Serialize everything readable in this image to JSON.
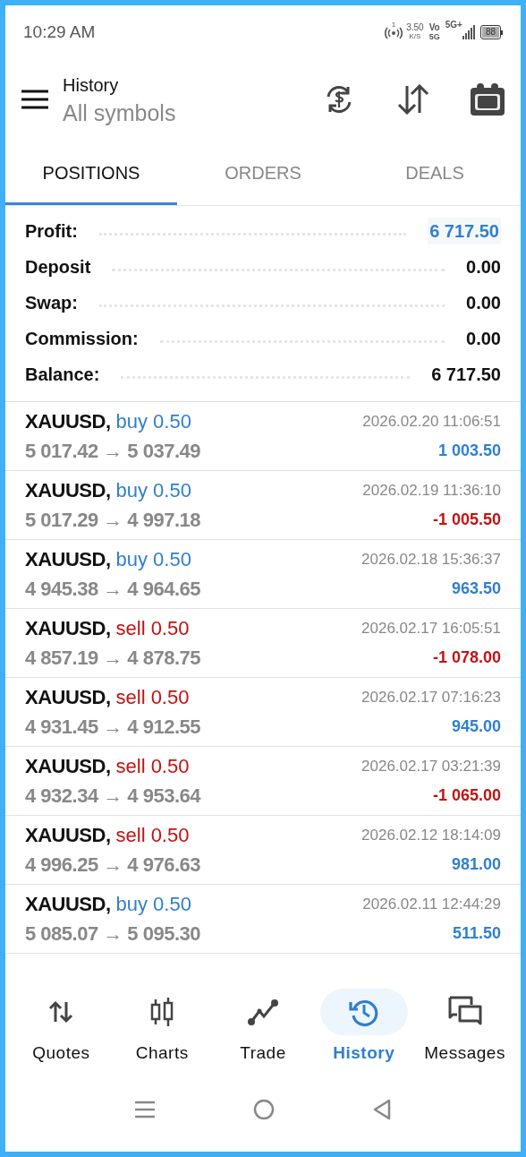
{
  "status_bar": {
    "time": "10:29 AM",
    "hotspot": "1",
    "speed": "3.50",
    "speed_unit": "K/S",
    "volte": "Vo",
    "volte_net": "5G",
    "network": "5G+",
    "battery": "88"
  },
  "header": {
    "title": "History",
    "subtitle": "All symbols"
  },
  "tabs": [
    {
      "label": "POSITIONS",
      "selected": true
    },
    {
      "label": "ORDERS",
      "selected": false
    },
    {
      "label": "DEALS",
      "selected": false
    }
  ],
  "summary": [
    {
      "label": "Profit:",
      "value": "6 717.50",
      "highlighted": true
    },
    {
      "label": "Deposit",
      "value": "0.00",
      "highlighted": false
    },
    {
      "label": "Swap:",
      "value": "0.00",
      "highlighted": false
    },
    {
      "label": "Commission:",
      "value": "0.00",
      "highlighted": false
    },
    {
      "label": "Balance:",
      "value": "6 717.50",
      "highlighted": false
    }
  ],
  "positions": [
    {
      "symbol": "XAUUSD,",
      "kind": "buy",
      "trade": "buy 0.50",
      "prices": "5 017.42 → 5 037.49",
      "time": "2026.02.20 11:06:51",
      "profit": "1 003.50",
      "negative": false
    },
    {
      "symbol": "XAUUSD,",
      "kind": "buy",
      "trade": "buy 0.50",
      "prices": "5 017.29 → 4 997.18",
      "time": "2026.02.19 11:36:10",
      "profit": "-1 005.50",
      "negative": true
    },
    {
      "symbol": "XAUUSD,",
      "kind": "buy",
      "trade": "buy 0.50",
      "prices": "4 945.38 → 4 964.65",
      "time": "2026.02.18 15:36:37",
      "profit": "963.50",
      "negative": false
    },
    {
      "symbol": "XAUUSD,",
      "kind": "sell",
      "trade": "sell 0.50",
      "prices": "4 857.19 → 4 878.75",
      "time": "2026.02.17 16:05:51",
      "profit": "-1 078.00",
      "negative": true
    },
    {
      "symbol": "XAUUSD,",
      "kind": "sell",
      "trade": "sell 0.50",
      "prices": "4 931.45 → 4 912.55",
      "time": "2026.02.17 07:16:23",
      "profit": "945.00",
      "negative": false
    },
    {
      "symbol": "XAUUSD,",
      "kind": "sell",
      "trade": "sell 0.50",
      "prices": "4 932.34 → 4 953.64",
      "time": "2026.02.17 03:21:39",
      "profit": "-1 065.00",
      "negative": true
    },
    {
      "symbol": "XAUUSD,",
      "kind": "sell",
      "trade": "sell 0.50",
      "prices": "4 996.25 → 4 976.63",
      "time": "2026.02.12 18:14:09",
      "profit": "981.00",
      "negative": false
    },
    {
      "symbol": "XAUUSD,",
      "kind": "buy",
      "trade": "buy 0.50",
      "prices": "5 085.07 → 5 095.30",
      "time": "2026.02.11 12:44:29",
      "profit": "511.50",
      "negative": false
    }
  ],
  "bottom_nav": [
    {
      "label": "Quotes",
      "kind": "quotes",
      "selected": false
    },
    {
      "label": "Charts",
      "kind": "charts",
      "selected": false
    },
    {
      "label": "Trade",
      "kind": "trade",
      "selected": false
    },
    {
      "label": "History",
      "kind": "history",
      "selected": true
    },
    {
      "label": "Messages",
      "kind": "messages",
      "selected": false
    }
  ]
}
